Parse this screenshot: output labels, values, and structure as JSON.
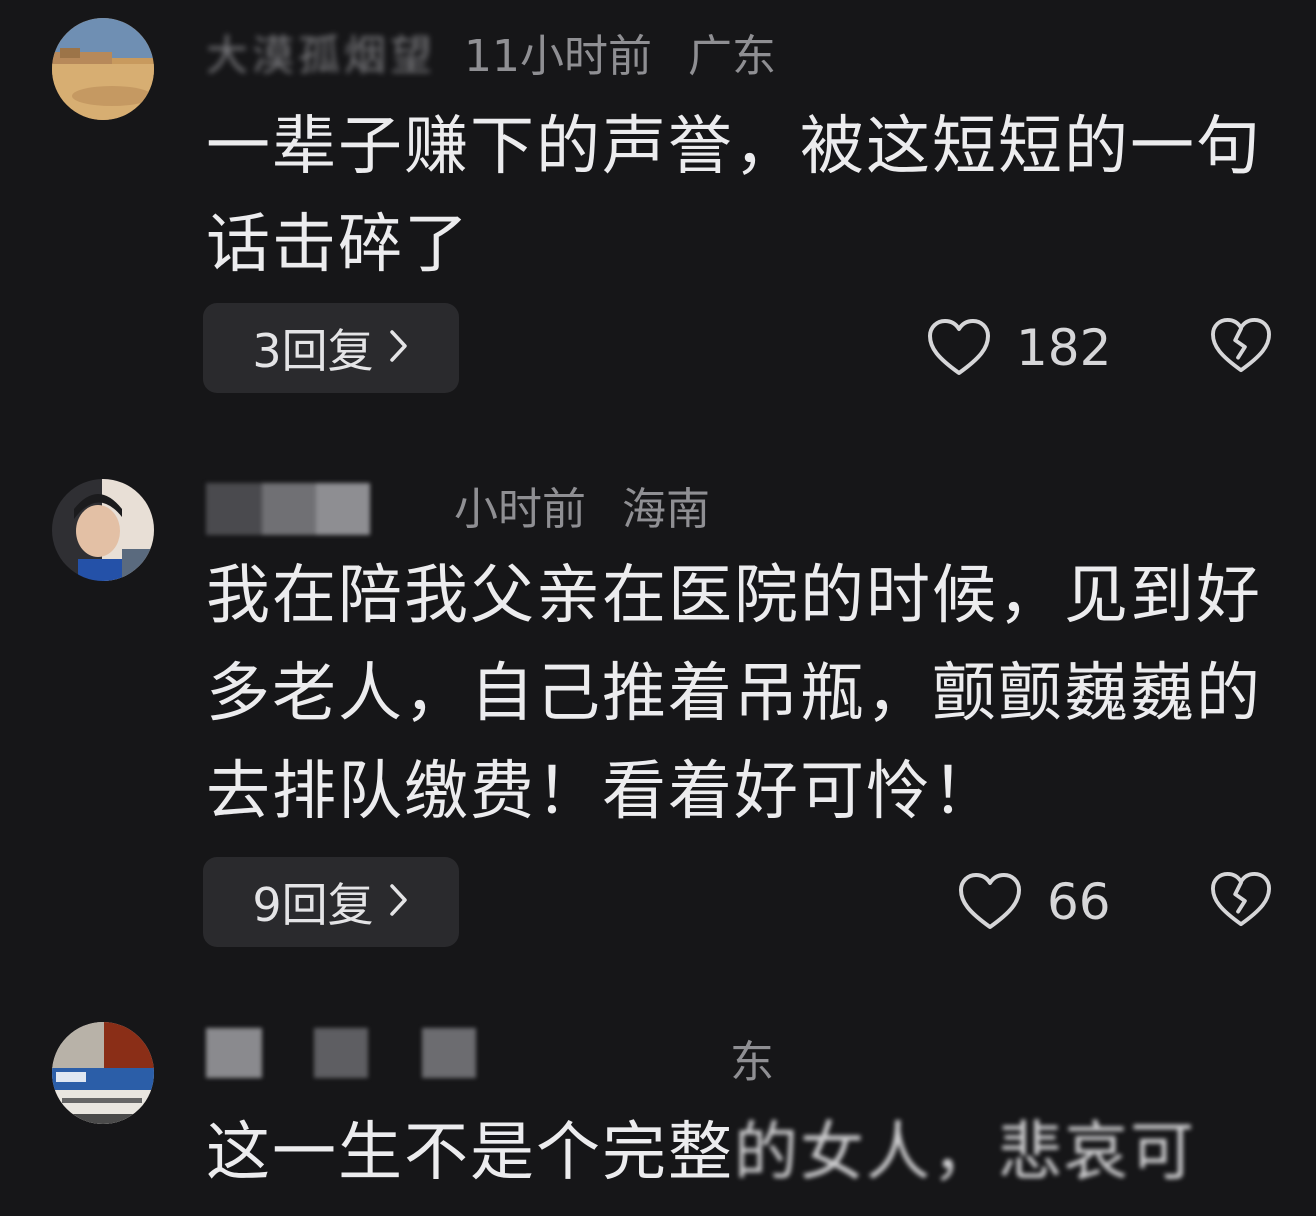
{
  "comments": [
    {
      "username": "大漠孤烟望",
      "time": "11小时前",
      "location": "广东",
      "text": "一辈子赚下的声誉，被这短短的一句话击碎了",
      "replies_label": "3回复",
      "likes": "182"
    },
    {
      "username": "",
      "time": "小时前",
      "location": "海南",
      "text": "我在陪我父亲在医院的时候，见到好多老人，自己推着吊瓶，颤颤巍巍的去排队缴费！看着好可怜！",
      "replies_label": "9回复",
      "likes": "66"
    },
    {
      "username": "",
      "time": "",
      "location": "东",
      "text_clear": "这一生不是个完整",
      "text_blurred": "的女人，悲哀可"
    }
  ],
  "icons": {
    "like": "heart-outline-icon",
    "dislike": "broken-heart-icon",
    "replies": "chevron-right-icon"
  },
  "colors": {
    "background": "#161618",
    "reply_button_bg": "#2a2a2d",
    "text": "#ececee",
    "meta": "#8f8f93"
  }
}
